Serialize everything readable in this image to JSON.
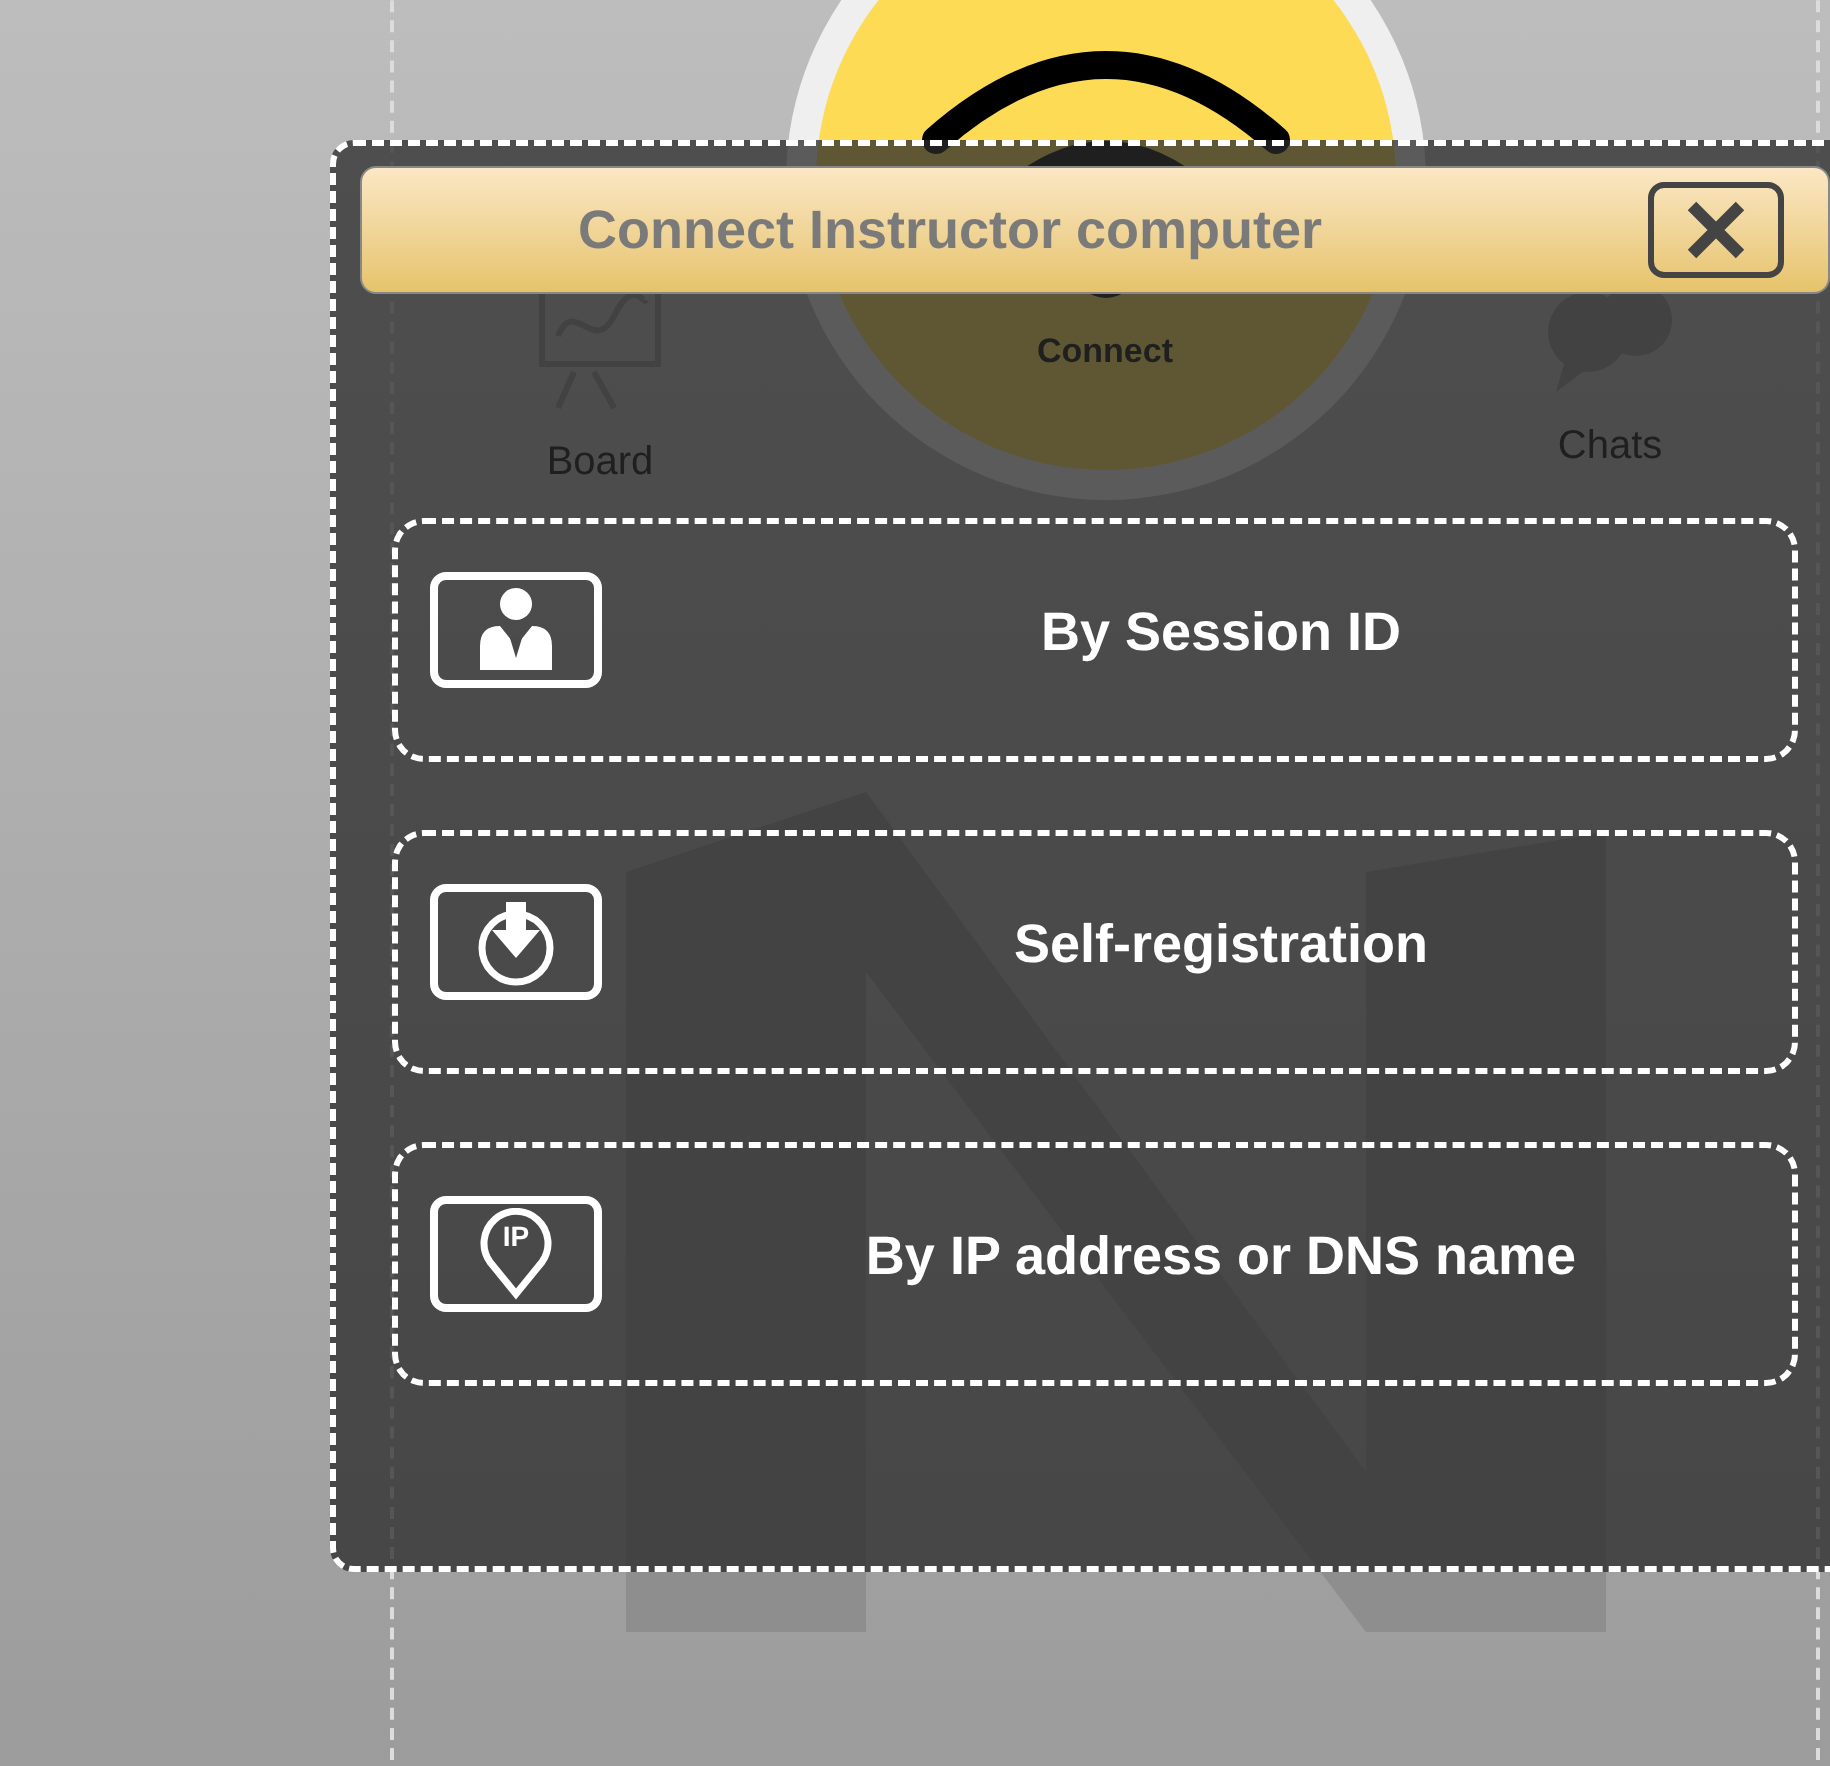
{
  "background": {
    "connect_label": "Connect",
    "items": [
      {
        "label": "Board",
        "kind": "board"
      },
      {
        "label": "Chats",
        "kind": "chats"
      }
    ]
  },
  "dialog": {
    "title": "Connect Instructor computer",
    "options": [
      {
        "label": "By Session ID",
        "kind": "session"
      },
      {
        "label": "Self-registration",
        "kind": "register"
      },
      {
        "label": "By IP address or DNS name",
        "kind": "ip",
        "icon_text": "IP"
      }
    ]
  }
}
